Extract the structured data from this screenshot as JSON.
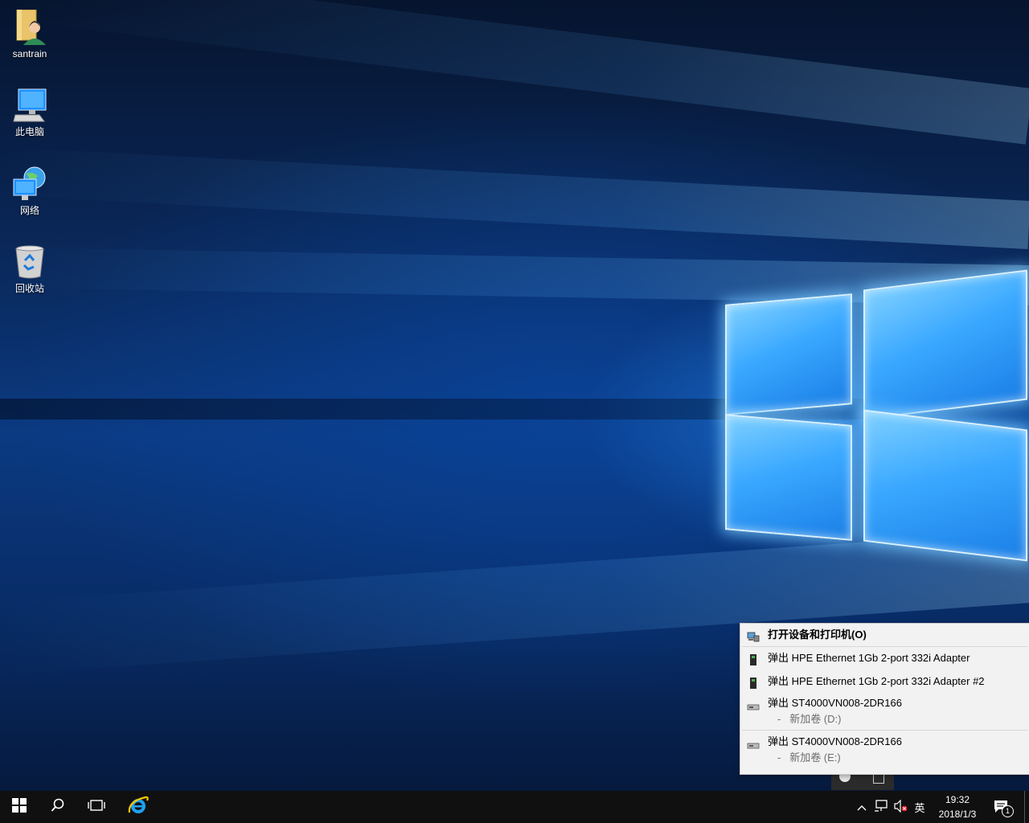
{
  "desktop": {
    "icons": [
      {
        "label": "santrain",
        "icon": "user-folder-icon"
      },
      {
        "label": "此电脑",
        "icon": "computer-icon"
      },
      {
        "label": "网络",
        "icon": "network-icon"
      },
      {
        "label": "回收站",
        "icon": "recycle-bin-icon"
      }
    ]
  },
  "menu": {
    "items": [
      {
        "label": "打开设备和打印机(O)",
        "icon": "devices-printers-icon",
        "bold": true
      },
      {
        "label": "弹出 HPE Ethernet 1Gb 2-port 332i Adapter",
        "icon": "network-adapter-icon"
      },
      {
        "label": "弹出 HPE Ethernet 1Gb 2-port 332i Adapter #2",
        "icon": "network-adapter-icon"
      },
      {
        "label": "弹出 ST4000VN008-2DR166",
        "sub": "新加卷 (D:)",
        "sub_prefix": "-",
        "icon": "drive-icon"
      },
      {
        "label": "弹出 ST4000VN008-2DR166",
        "sub": "新加卷 (E:)",
        "sub_prefix": "-",
        "icon": "drive-icon"
      }
    ]
  },
  "taskbar": {
    "start_icon": "windows-logo-icon",
    "search_icon": "search-icon",
    "task_view_icon": "task-view-icon",
    "pinned": [
      "internet-explorer-icon"
    ],
    "tray": {
      "overflow_icon": "chevron-up-icon",
      "network_icon": "network-status-icon",
      "volume_icon": "volume-muted-icon",
      "ime_label": "英"
    },
    "clock": {
      "time": "19:32",
      "date": "2018/1/3"
    },
    "notifications": {
      "icon": "action-center-icon",
      "count": "1"
    }
  },
  "colors": {
    "taskbar": "#101010",
    "menu_bg": "#f2f2f2",
    "accent_blue": "#1a7fe6"
  }
}
